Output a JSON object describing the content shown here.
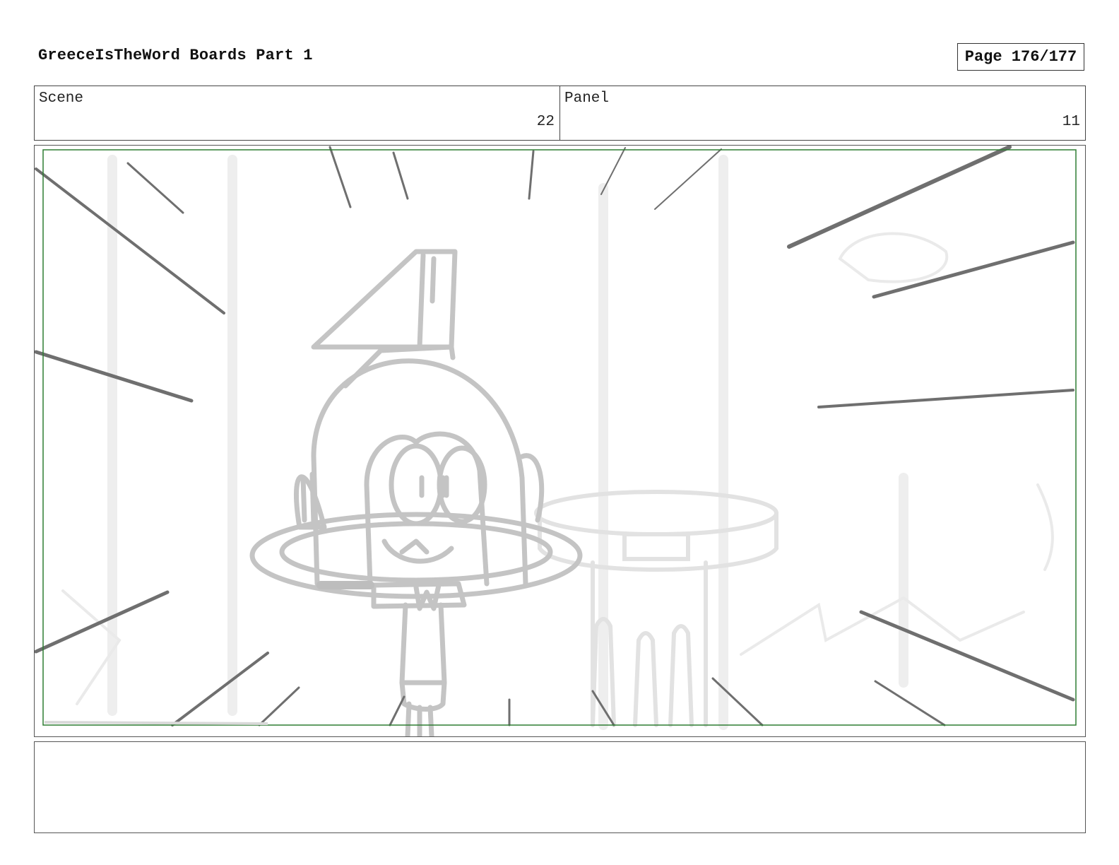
{
  "header": {
    "title": "GreeceIsTheWord Boards Part 1",
    "page": "Page 176/177"
  },
  "info": {
    "scene_label": "Scene",
    "scene_value": "22",
    "panel_label": "Panel",
    "panel_value": "11"
  },
  "frame": {
    "description_icons": [
      "speed-lines",
      "character-sketch",
      "pedestal-table-sketch"
    ],
    "safe_area_color": "#2e7d32",
    "speed_line_color": "#6f6f6f",
    "sketch_color": "#c4c4c4"
  },
  "notes": {
    "text": ""
  }
}
